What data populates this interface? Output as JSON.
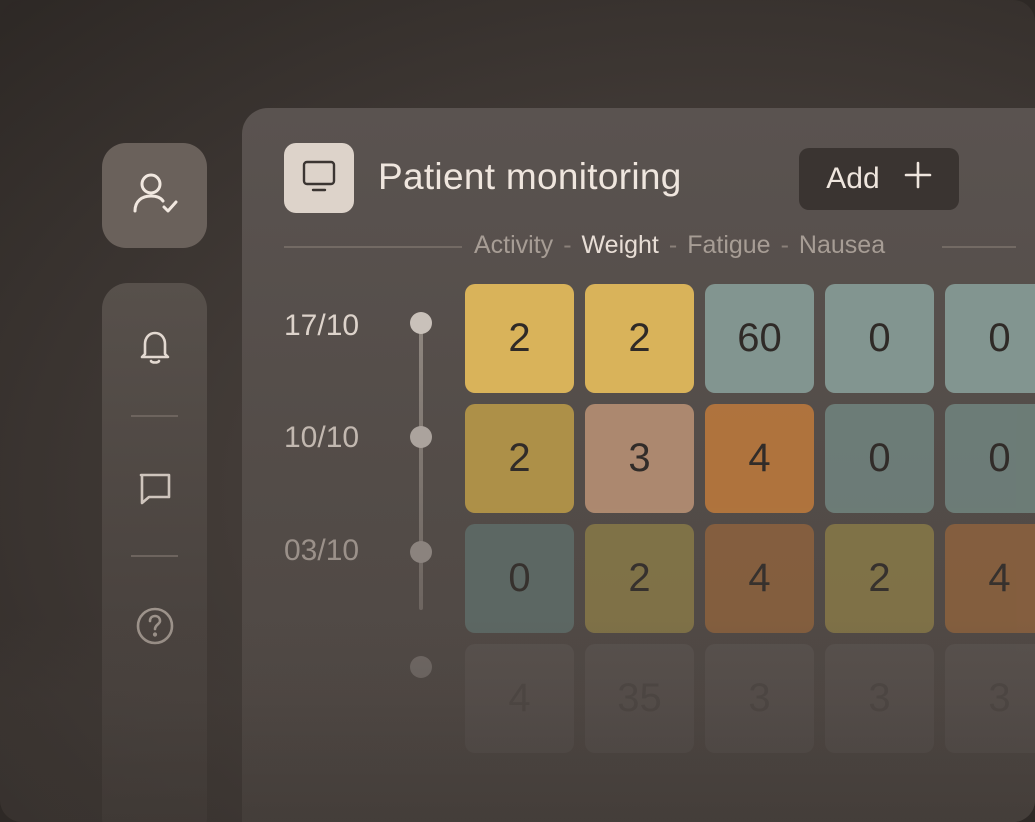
{
  "header": {
    "title": "Patient monitoring",
    "add_label": "Add",
    "add_icon": "plus-icon",
    "app_icon": "monitor-icon"
  },
  "sidebar": {
    "profile_icon": "user-check-icon",
    "items": [
      {
        "icon": "bell-icon"
      },
      {
        "icon": "chat-icon"
      },
      {
        "icon": "help-icon"
      }
    ]
  },
  "tabs": [
    {
      "label": "Activity",
      "active": false
    },
    {
      "label": "Weight",
      "active": true
    },
    {
      "label": "Fatigue",
      "active": false
    },
    {
      "label": "Nausea",
      "active": false
    }
  ],
  "tab_separator": "-",
  "dates": [
    "17/10",
    "10/10",
    "03/10",
    ""
  ],
  "grid": [
    [
      "2",
      "2",
      "60",
      "0",
      "0"
    ],
    [
      "2",
      "3",
      "4",
      "0",
      "0"
    ],
    [
      "0",
      "2",
      "4",
      "2",
      "4"
    ],
    [
      "4",
      "35",
      "3",
      "3",
      "3"
    ]
  ],
  "colors": {
    "yellow": "#d9b35a",
    "yellow_dim": "#b59648",
    "olive": "#8c7d48",
    "peach": "#b48e73",
    "orange": "#b7773d",
    "orange_dim": "#92643d",
    "teal": "#829590",
    "teal_dim": "#6f807b",
    "teal_dark": "#60706c",
    "grey": "#696260"
  }
}
